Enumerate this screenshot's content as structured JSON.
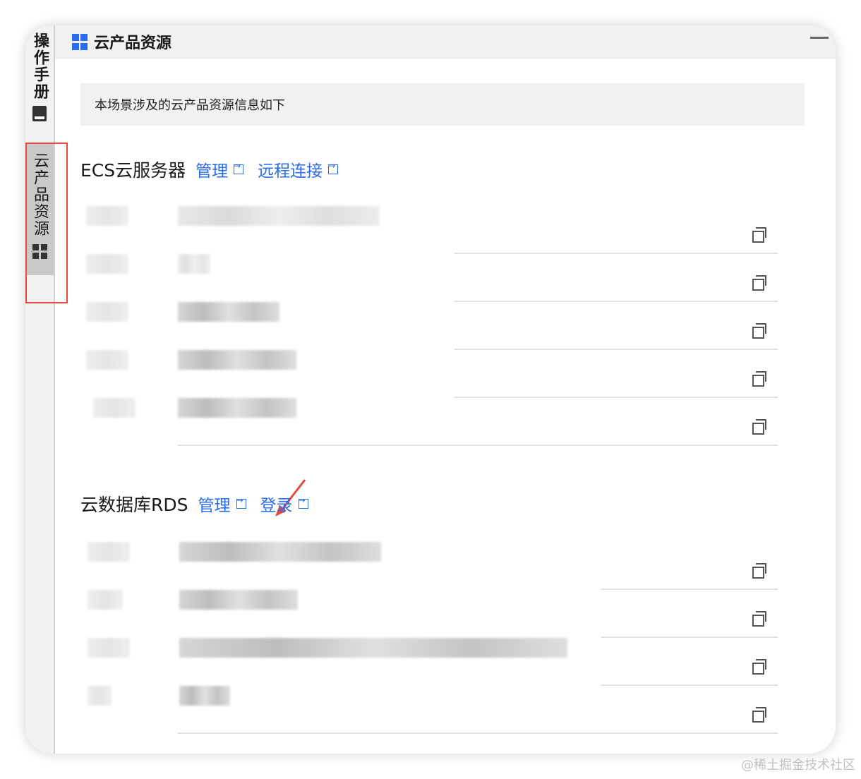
{
  "rail": {
    "manual_label": "操作手册",
    "resources_label": "云产品资源"
  },
  "header": {
    "title": "云产品资源"
  },
  "info": {
    "text": "本场景涉及的云产品资源信息如下"
  },
  "ecs": {
    "title": "ECS云服务器",
    "link_manage": "管理",
    "link_remote": "远程连接"
  },
  "rds": {
    "title": "云数据库RDS",
    "link_manage": "管理",
    "link_login": "登录"
  },
  "watermark": "@稀土掘金技术社区",
  "colors": {
    "accent": "#2a6cf0",
    "highlight": "#e34a3b"
  }
}
